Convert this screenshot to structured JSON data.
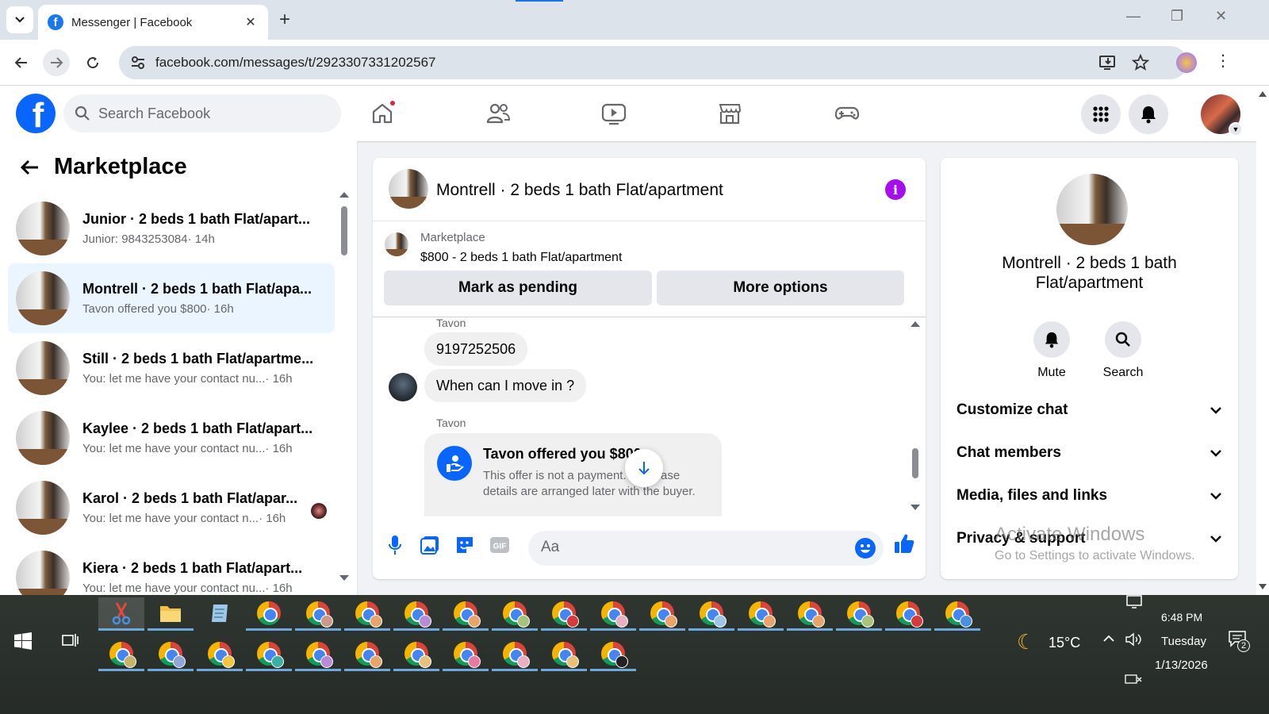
{
  "browser": {
    "tab_title": "Messenger | Facebook",
    "url": "facebook.com/messages/t/2923307331202567"
  },
  "fb": {
    "search_placeholder": "Search Facebook"
  },
  "left": {
    "title": "Marketplace",
    "conversations": [
      {
        "name": "Junior · 2 beds 1 bath Flat/apart...",
        "preview": "Junior: 9843253084",
        "time": " · 14h"
      },
      {
        "name": "Montrell · 2 beds 1 bath Flat/apa...",
        "preview": "Tavon offered you $800",
        "time": " · 16h"
      },
      {
        "name": "Still · 2 beds 1 bath Flat/apartme...",
        "preview": "You: let me have your contact nu...",
        "time": " · 16h"
      },
      {
        "name": "Kaylee · 2 beds 1 bath Flat/apart...",
        "preview": "You: let me have your contact nu...",
        "time": " · 16h"
      },
      {
        "name": "Karol · 2 beds 1 bath Flat/apar...",
        "preview": "You: let me have your contact n...",
        "time": " · 16h"
      },
      {
        "name": "Kiera · 2 beds 1 bath Flat/apart...",
        "preview": "You: let me have your contact nu...",
        "time": " · 16h"
      }
    ]
  },
  "chat": {
    "title": "Montrell · 2 beds 1 bath Flat/apartment",
    "marketplace_label": "Marketplace",
    "listing": "$800 - 2 beds 1 bath Flat/apartment",
    "mark_pending": "Mark as pending",
    "more_options": "More options",
    "sender1": "Tavon",
    "msg1": "9197252506",
    "msg2": "When can I move in ?",
    "sender2": "Tavon",
    "offer_title": "Tavon offered you $800",
    "offer_desc": "This offer is not a payment. Purchase details are arranged later with the buyer.",
    "composer_placeholder": "Aa"
  },
  "right": {
    "name": "Montrell · 2 beds 1 bath Flat/apartment",
    "mute": "Mute",
    "search": "Search",
    "sections": [
      "Customize chat",
      "Chat members",
      "Media, files and links",
      "Privacy & support"
    ]
  },
  "watermark": {
    "line1": "Activate Windows",
    "line2": "Go to Settings to activate Windows."
  },
  "taskbar": {
    "weather": "15°C",
    "time": "6:48 PM",
    "day": "Tuesday",
    "date": "1/13/2026",
    "notif_count": "2"
  }
}
